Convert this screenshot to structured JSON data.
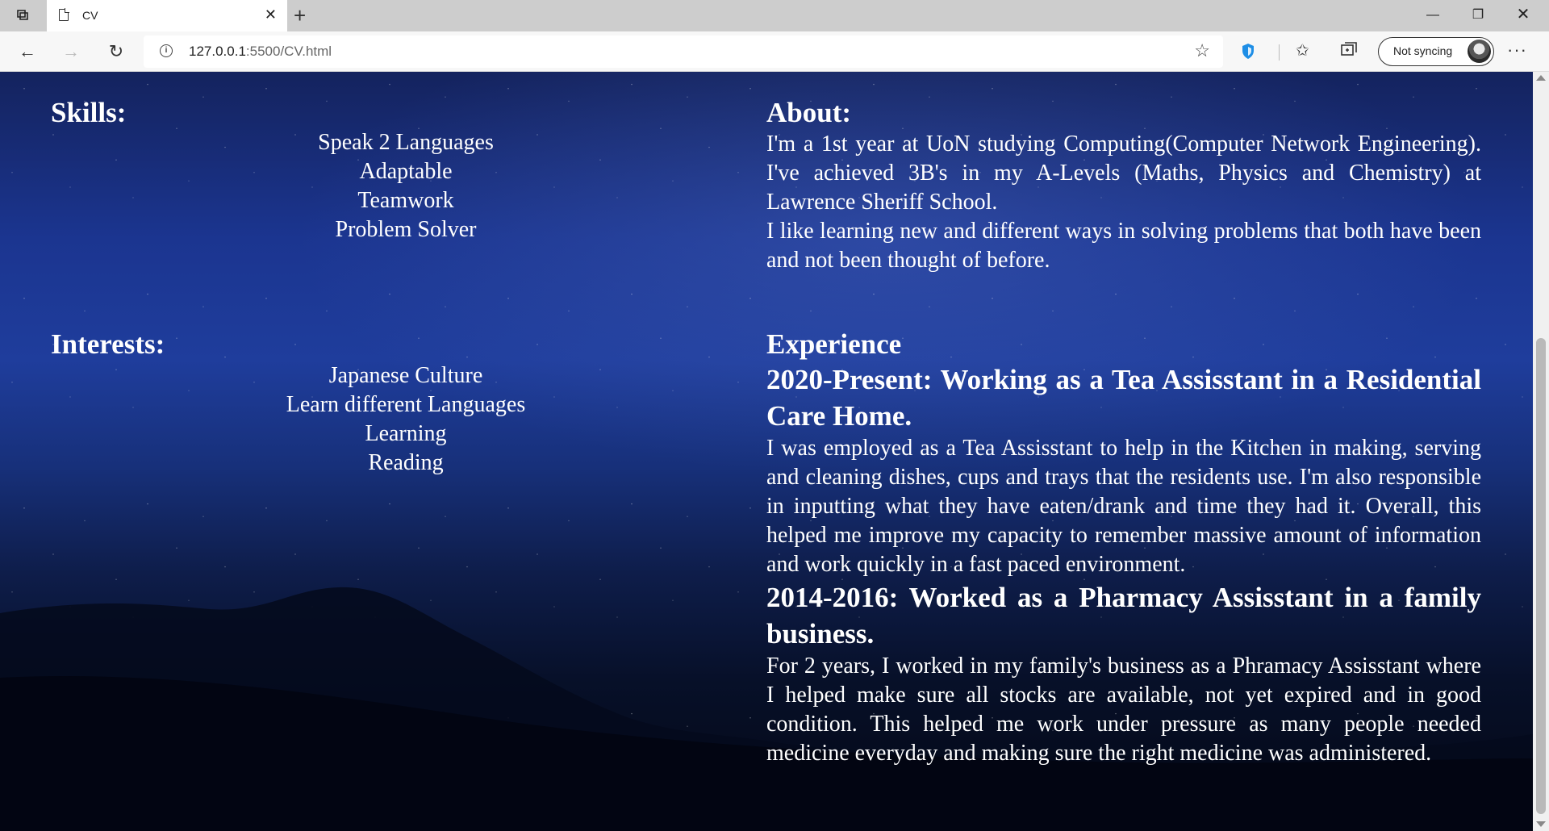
{
  "browser": {
    "tab": {
      "title": "CV"
    },
    "address": {
      "host": "127.0.0.1",
      "path": ":5500/CV.html"
    },
    "sync_label": "Not syncing",
    "icons": {
      "tab_actions": "tab-actions-icon",
      "page": "page-icon",
      "new_tab": "plus-icon",
      "back": "back-arrow-icon",
      "forward": "forward-arrow-icon",
      "reload": "reload-icon",
      "info": "info-icon",
      "favorite": "star-icon",
      "tracking": "shield-icon",
      "favorites": "favorites-icon",
      "collections": "collections-icon",
      "menu": "more-icon"
    }
  },
  "cv": {
    "skills": {
      "heading": "Skills:",
      "items": [
        "Speak 2 Languages",
        "Adaptable",
        "Teamwork",
        "Problem Solver"
      ]
    },
    "interests": {
      "heading": "Interests:",
      "items": [
        "Japanese Culture",
        "Learn different Languages",
        "Learning",
        "Reading"
      ]
    },
    "about": {
      "heading": "About:",
      "paragraphs": [
        "I'm a 1st year at UoN studying Computing(Computer Network Engineering). I've achieved 3B's in my A-Levels (Maths, Physics and Chemistry) at Lawrence Sheriff School.",
        "I like learning new and different ways in solving problems that both have been and not been thought of before."
      ]
    },
    "experience": {
      "heading": "Experience",
      "jobs": [
        {
          "title": "2020-Present: Working as a Tea Assisstant in a Residential Care Home.",
          "description": "I was employed as a Tea Assisstant to help in the Kitchen in making, serving and cleaning dishes, cups and trays that the residents use. I'm also responsible in inputting what they have eaten/drank and time they had it. Overall, this helped me improve my capacity to remember massive amount of information and work quickly in a fast paced environment."
        },
        {
          "title": "2014-2016: Worked as a Pharmacy Assisstant in a family business.",
          "description": "For 2 years, I worked in my family's business as a Phramacy Assisstant where I helped make sure all stocks are available, not yet expired and in good condition. This helped me work under pressure as many people needed medicine everyday and making sure the right medicine was administered."
        }
      ]
    }
  }
}
